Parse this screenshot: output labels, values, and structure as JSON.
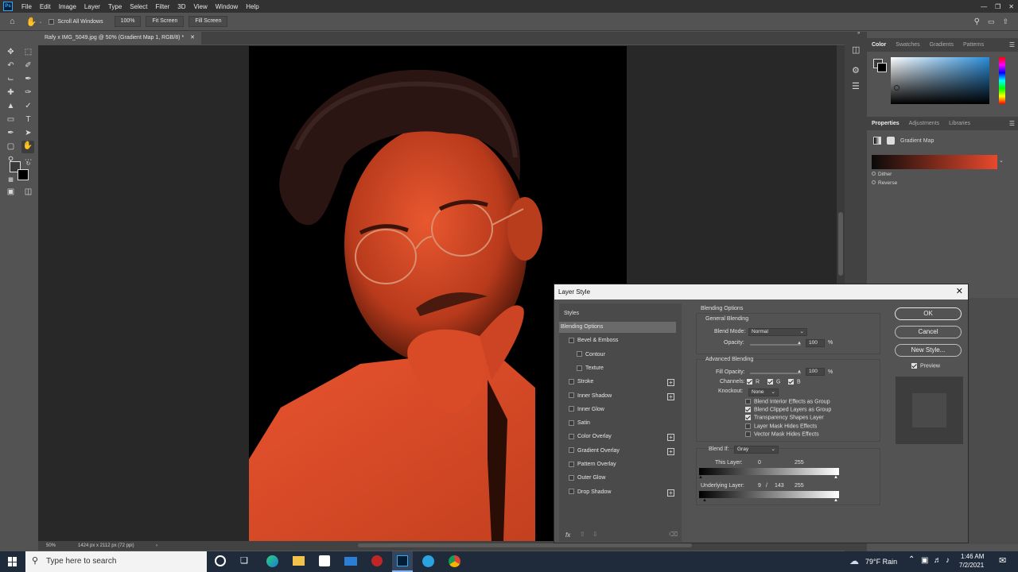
{
  "menubar": {
    "app_logo": "Ps",
    "items": [
      "File",
      "Edit",
      "Image",
      "Layer",
      "Type",
      "Select",
      "Filter",
      "3D",
      "View",
      "Window",
      "Help"
    ]
  },
  "options_bar": {
    "scroll_all_windows": "Scroll All Windows",
    "zoom_value": "100%",
    "fit_screen": "Fit Screen",
    "fill_screen": "Fill Screen"
  },
  "document": {
    "tab_title": "Rafy x IMG_5049.jpg @ 50% (Gradient Map 1, RGB/8) *",
    "status_zoom": "50%",
    "status_info": "1424 px x 2112 px (72 ppi)"
  },
  "color_panel": {
    "tabs": [
      "Color",
      "Swatches",
      "Gradients",
      "Patterns"
    ]
  },
  "properties_panel": {
    "tabs": [
      "Properties",
      "Adjustments",
      "Libraries"
    ],
    "adjustment_name": "Gradient Map",
    "dither": "Dither",
    "reverse": "Reverse",
    "gradient_start": "#0a0a0a",
    "gradient_end": "#e8492c"
  },
  "dialog": {
    "title": "Layer Style",
    "styles_header": "Styles",
    "styles": [
      {
        "label": "Blending Options",
        "checkbox": false,
        "plus": false,
        "active": true
      },
      {
        "label": "Bevel & Emboss",
        "checkbox": true,
        "plus": false
      },
      {
        "label": "Contour",
        "checkbox": true,
        "plus": false,
        "indent": true
      },
      {
        "label": "Texture",
        "checkbox": true,
        "plus": false,
        "indent": true
      },
      {
        "label": "Stroke",
        "checkbox": true,
        "plus": true
      },
      {
        "label": "Inner Shadow",
        "checkbox": true,
        "plus": true
      },
      {
        "label": "Inner Glow",
        "checkbox": true,
        "plus": false
      },
      {
        "label": "Satin",
        "checkbox": true,
        "plus": false
      },
      {
        "label": "Color Overlay",
        "checkbox": true,
        "plus": true
      },
      {
        "label": "Gradient Overlay",
        "checkbox": true,
        "plus": true
      },
      {
        "label": "Pattern Overlay",
        "checkbox": true,
        "plus": false
      },
      {
        "label": "Outer Glow",
        "checkbox": true,
        "plus": false
      },
      {
        "label": "Drop Shadow",
        "checkbox": true,
        "plus": true
      }
    ],
    "fx_label": "fx",
    "blending_options_title": "Blending Options",
    "general_blending": "General Blending",
    "blend_mode_label": "Blend Mode:",
    "blend_mode_value": "Normal",
    "opacity_label": "Opacity:",
    "opacity_value": "100",
    "percent": "%",
    "advanced_blending": "Advanced Blending",
    "fill_opacity_label": "Fill Opacity:",
    "fill_opacity_value": "100",
    "channels_label": "Channels:",
    "channels": [
      "R",
      "G",
      "B"
    ],
    "knockout_label": "Knockout:",
    "knockout_value": "None",
    "options": [
      {
        "label": "Blend Interior Effects as Group",
        "checked": false
      },
      {
        "label": "Blend Clipped Layers as Group",
        "checked": true
      },
      {
        "label": "Transparency Shapes Layer",
        "checked": true
      },
      {
        "label": "Layer Mask Hides Effects",
        "checked": false
      },
      {
        "label": "Vector Mask Hides Effects",
        "checked": false
      }
    ],
    "blend_if_label": "Blend If:",
    "blend_if_value": "Gray",
    "this_layer_label": "This Layer:",
    "this_layer_low": "0",
    "this_layer_high": "255",
    "underlying_label": "Underlying Layer:",
    "underlying_low": "9",
    "underlying_slash": "/",
    "underlying_mid": "143",
    "underlying_high": "255",
    "ok": "OK",
    "cancel": "Cancel",
    "new_style": "New Style...",
    "preview": "Preview"
  },
  "taskbar": {
    "search_placeholder": "Type here to search",
    "weather": "79°F  Rain",
    "time": "1:46 AM",
    "date": "7/2/2021"
  }
}
